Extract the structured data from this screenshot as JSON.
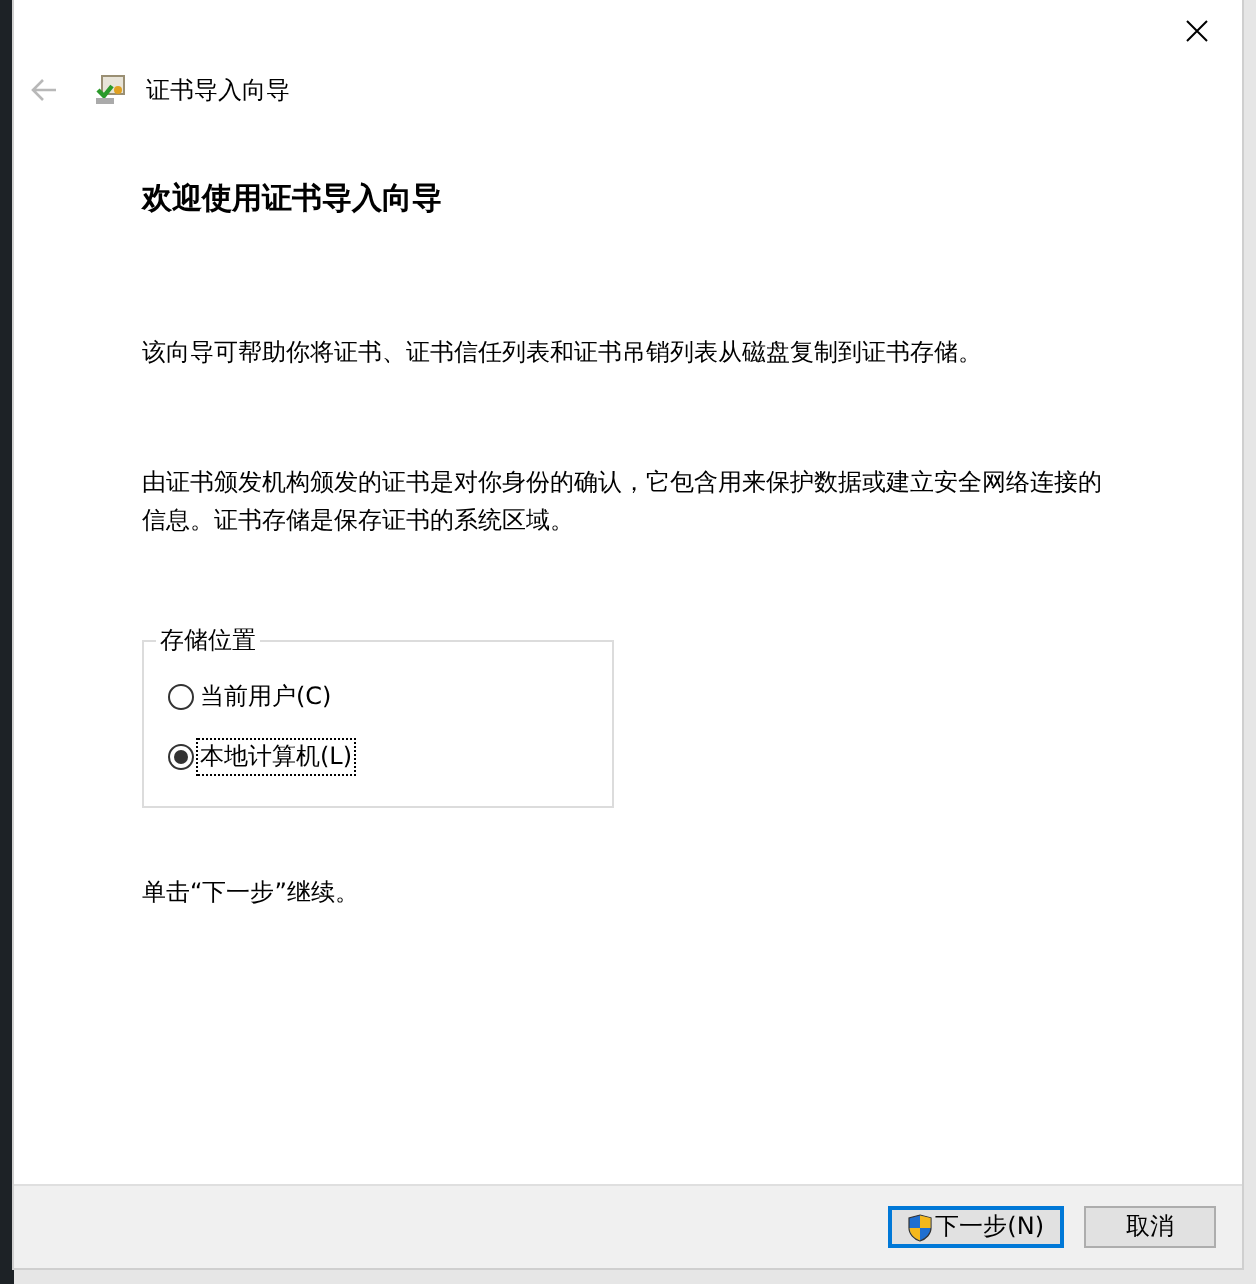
{
  "window": {
    "title": "证书导入向导"
  },
  "heading": "欢迎使用证书导入向导",
  "paragraphs": [
    "该向导可帮助你将证书、证书信任列表和证书吊销列表从磁盘复制到证书存储。",
    "由证书颁发机构颁发的证书是对你身份的确认，它包含用来保护数据或建立安全网络连接的信息。证书存储是保存证书的系统区域。"
  ],
  "store_location": {
    "legend": "存储位置",
    "options": [
      {
        "label": "当前用户(C)",
        "selected": false
      },
      {
        "label": "本地计算机(L)",
        "selected": true
      }
    ]
  },
  "note": "单击“下一步”继续。",
  "buttons": [
    {
      "label": "下一步(N)",
      "kind": "shield",
      "default": true
    },
    {
      "label": "取消",
      "kind": "plain",
      "default": false
    }
  ]
}
